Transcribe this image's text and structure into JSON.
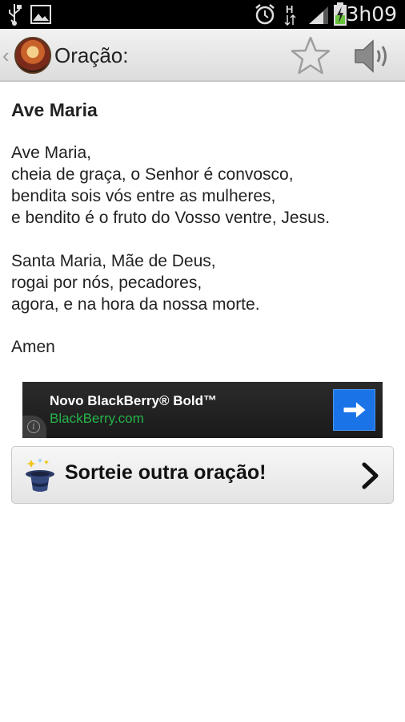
{
  "status_bar": {
    "time": "3h09",
    "icons": [
      "usb-icon",
      "image-icon",
      "alarm-icon",
      "hspa-icon",
      "signal-icon",
      "battery-charging-icon"
    ]
  },
  "action_bar": {
    "title": "Oração:",
    "icons": [
      "back-chevron-icon",
      "app-logo",
      "star-icon",
      "speaker-icon"
    ]
  },
  "prayer": {
    "title": "Ave Maria",
    "stanzas": [
      "Ave Maria,\ncheia de graça, o Senhor é convosco,\nbendita sois vós entre as mulheres,\ne bendito é o fruto do Vosso ventre, Jesus.",
      "Santa Maria, Mãe de Deus,\nrogai por nós, pecadores,\nagora, e na hora da nossa morte.",
      "Amen"
    ]
  },
  "ad": {
    "title": "Novo BlackBerry® Bold™",
    "url": "BlackBerry.com",
    "info_glyph": "i",
    "colors": {
      "background": "#222222",
      "url": "#26b34a",
      "button": "#1a74e8"
    }
  },
  "random_button": {
    "label": "Sorteie outra oração!"
  }
}
